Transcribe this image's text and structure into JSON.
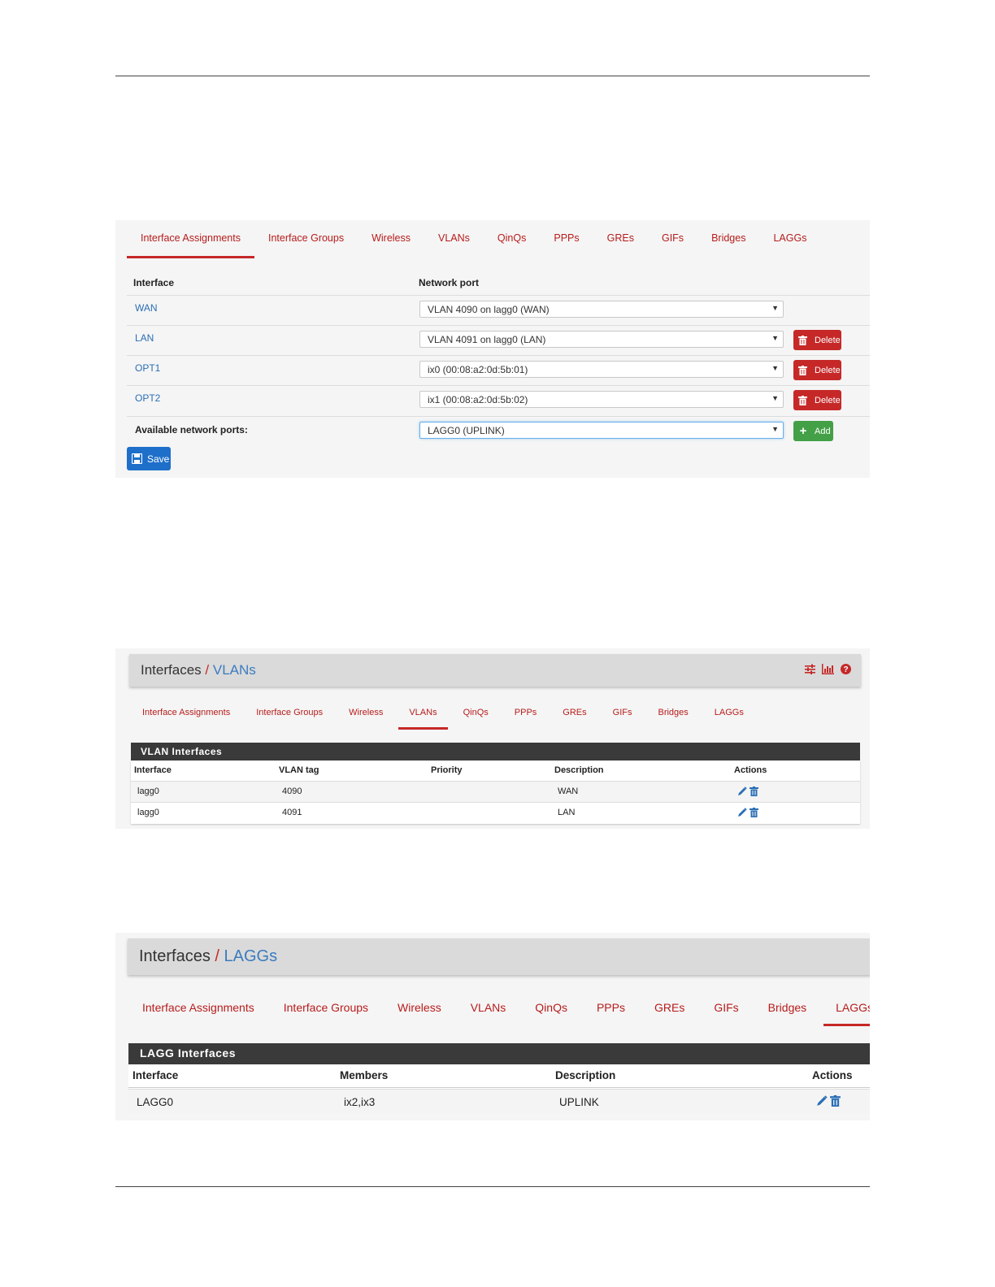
{
  "tabs": [
    "Interface Assignments",
    "Interface Groups",
    "Wireless",
    "VLANs",
    "QinQs",
    "PPPs",
    "GREs",
    "GIFs",
    "Bridges",
    "LAGGs"
  ],
  "assignments": {
    "active_tab": "Interface Assignments",
    "col_interface": "Interface",
    "col_network_port": "Network port",
    "rows": [
      {
        "interface": "WAN",
        "port": "VLAN 4090 on lagg0 (WAN)",
        "delete": ""
      },
      {
        "interface": "LAN",
        "port": "VLAN 4091 on lagg0 (LAN)",
        "delete": "Delete"
      },
      {
        "interface": "OPT1",
        "port": "ix0 (00:08:a2:0d:5b:01)",
        "delete": "Delete"
      },
      {
        "interface": "OPT2",
        "port": "ix1 (00:08:a2:0d:5b:02)",
        "delete": "Delete"
      }
    ],
    "available_label": "Available network ports:",
    "available_value": "LAGG0 (UPLINK)",
    "add_label": "Add",
    "save_label": "Save"
  },
  "vlans": {
    "crumb_parent": "Interfaces",
    "crumb_sep": "/",
    "crumb_current": "VLANs",
    "active_tab": "VLANs",
    "table_title": "VLAN Interfaces",
    "columns": [
      "Interface",
      "VLAN tag",
      "Priority",
      "Description",
      "Actions"
    ],
    "rows": [
      {
        "interface": "lagg0",
        "tag": "4090",
        "priority": "",
        "description": "WAN"
      },
      {
        "interface": "lagg0",
        "tag": "4091",
        "priority": "",
        "description": "LAN"
      }
    ],
    "header_icons": [
      "sliders-icon",
      "bar-chart-icon",
      "help-icon"
    ]
  },
  "laggs": {
    "crumb_parent": "Interfaces",
    "crumb_sep": "/",
    "crumb_current": "LAGGs",
    "active_tab": "LAGGs",
    "table_title": "LAGG Interfaces",
    "columns": [
      "Interface",
      "Members",
      "Description",
      "Actions"
    ],
    "rows": [
      {
        "interface": "LAGG0",
        "members": "ix2,ix3",
        "description": "UPLINK"
      }
    ]
  },
  "colors": {
    "accent_red": "#c62828",
    "link_blue": "#2a6eb5",
    "save_blue": "#1e6fc9",
    "add_green": "#43a047",
    "table_header": "#3a3a3a"
  }
}
